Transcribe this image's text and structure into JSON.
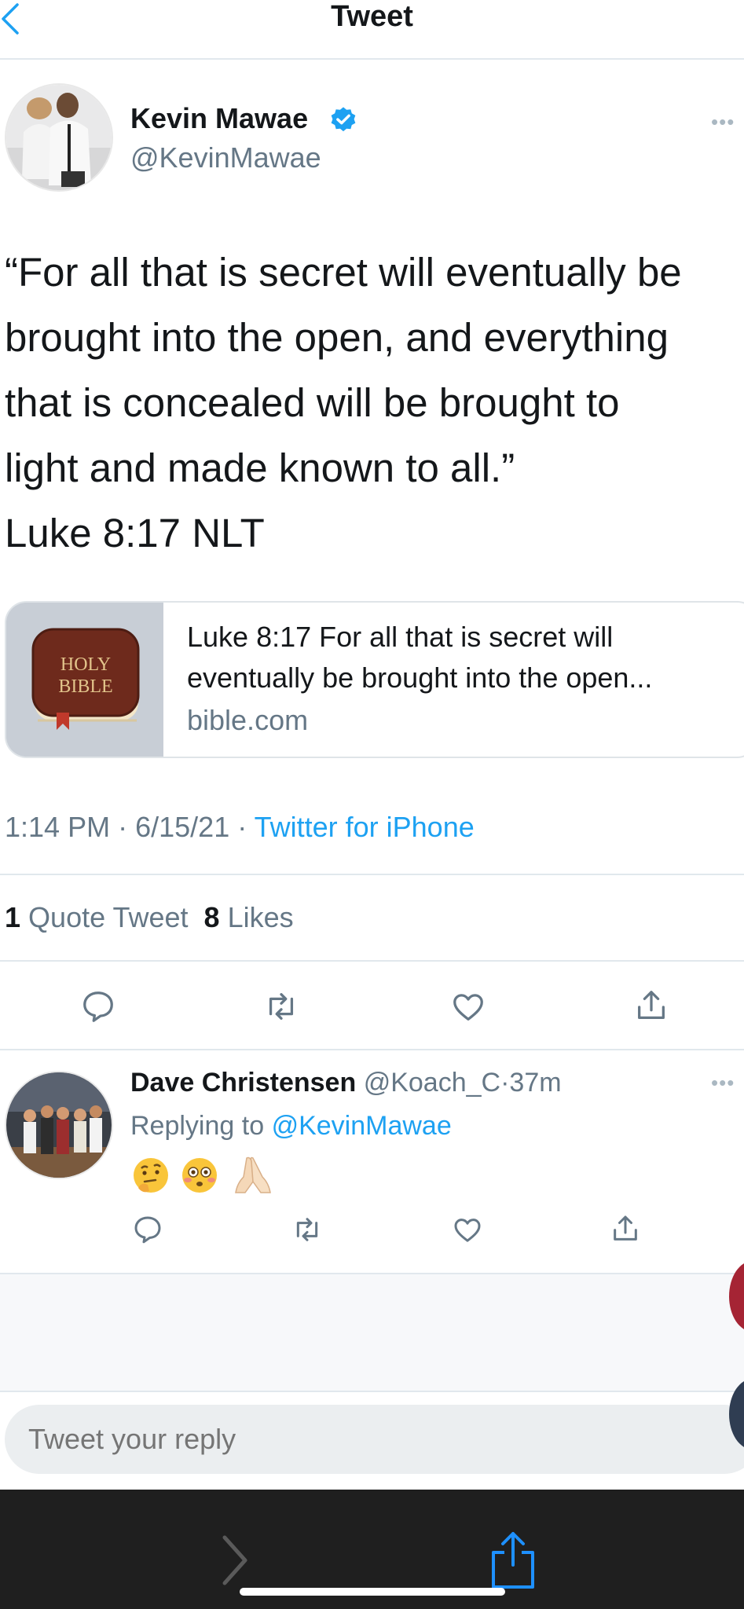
{
  "header": {
    "title": "Tweet",
    "back_icon": "chevron-left-icon"
  },
  "tweet": {
    "author_name": "Kevin Mawae",
    "author_handle": "@KevinMawae",
    "verified": true,
    "text_lines": [
      "“For all that is secret will eventually be",
      "brought into the open, and everything",
      "that is concealed will be brought to",
      "light and made known to all.”",
      "Luke 8:17 NLT"
    ],
    "card": {
      "thumb_line1": "HOLY",
      "thumb_line2": "BIBLE",
      "title_line1": "Luke 8:17 For all that is secret will",
      "title_line2": "eventually be brought into the open...",
      "domain": "bible.com"
    },
    "time": "1:14 PM",
    "date": "6/15/21",
    "source": "Twitter for iPhone",
    "separator": "·",
    "quote_count": "1",
    "quote_label": "Quote Tweet",
    "like_count": "8",
    "like_label": "Likes"
  },
  "reply": {
    "name": "Dave Christensen",
    "handle": "@Koach_C",
    "separator": "·",
    "time": "37m",
    "replying_label": "Replying to",
    "replying_handle": "@KevinMawae",
    "emojis": [
      "thinking-face",
      "flushed-face",
      "folded-hands"
    ]
  },
  "compose": {
    "placeholder": "Tweet your reply"
  },
  "colors": {
    "link": "#1da1f2",
    "secondary_text": "#657786",
    "primary_text": "#14171a",
    "divider": "#e1e8ed",
    "browser_bar": "#1f1f1f"
  }
}
